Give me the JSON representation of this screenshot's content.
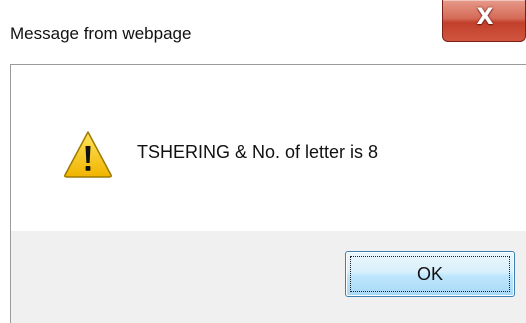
{
  "dialog": {
    "title": "Message from webpage",
    "close_glyph": "X",
    "message": "TSHERING  & No. of letter is 8",
    "icon": "warning-icon",
    "ok_label": "OK"
  },
  "colors": {
    "close_button": "#c1402b",
    "ok_button_border": "#3c7fb1",
    "button_area": "#f0f0f0",
    "warning_fill": "#f5c400"
  }
}
